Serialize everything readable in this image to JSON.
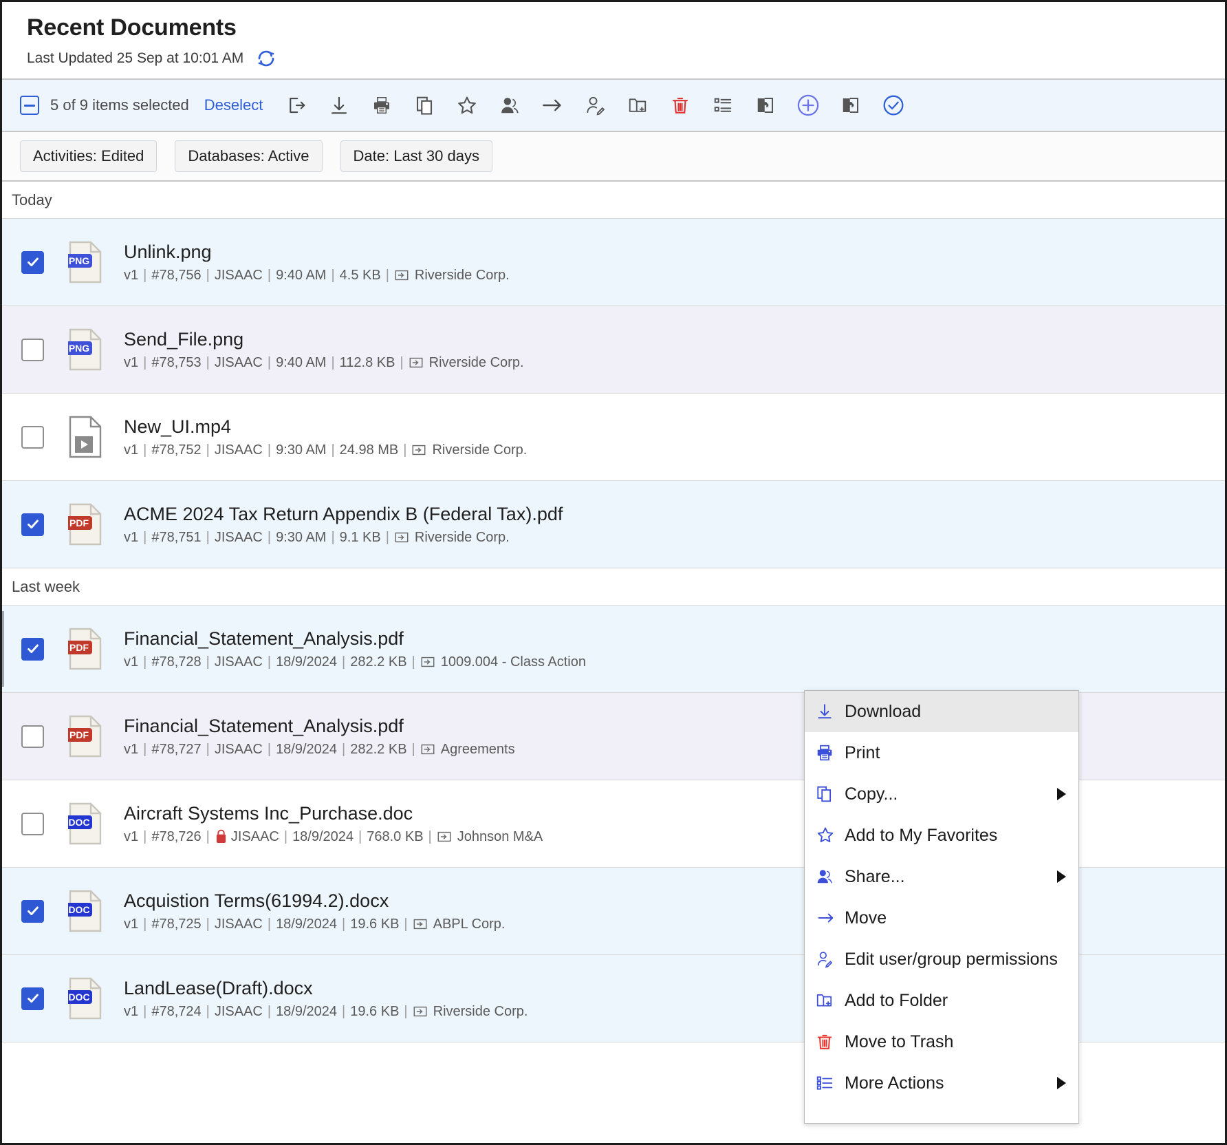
{
  "header": {
    "title": "Recent Documents",
    "last_updated": "Last Updated 25 Sep at 10:01 AM",
    "refresh_icon": "refresh-icon"
  },
  "toolbar": {
    "selected_text": "5 of 9 items selected",
    "deselect_label": "Deselect",
    "icons": [
      "exit-icon",
      "download-icon",
      "print-icon",
      "copy-icon",
      "star-icon",
      "share-user-icon",
      "move-arrow-icon",
      "edit-permissions-icon",
      "add-to-folder-icon",
      "trash-icon",
      "more-actions-icon",
      "puzzle-left-icon",
      "add-circle-icon",
      "puzzle-right-icon",
      "check-circle-icon"
    ],
    "accent_color": "#2f5fd8",
    "danger_color": "#e03131"
  },
  "filters": [
    {
      "label": "Activities: Edited"
    },
    {
      "label": "Databases: Active"
    },
    {
      "label": "Date: Last 30 days"
    }
  ],
  "groups": [
    {
      "label": "Today",
      "rows": [
        {
          "name": "Unlink.png",
          "type": "PNG",
          "checked": true,
          "style": "sel",
          "accent": false,
          "locked": false,
          "version": "v1",
          "id": "#78,756",
          "user": "JISAAC",
          "time": "9:40 AM",
          "size": "4.5 KB",
          "database": "Riverside Corp."
        },
        {
          "name": "Send_File.png",
          "type": "PNG",
          "checked": false,
          "style": "alt",
          "accent": false,
          "locked": false,
          "version": "v1",
          "id": "#78,753",
          "user": "JISAAC",
          "time": "9:40 AM",
          "size": "112.8 KB",
          "database": "Riverside Corp."
        },
        {
          "name": "New_UI.mp4",
          "type": "VIDEO",
          "checked": false,
          "style": "plain",
          "accent": false,
          "locked": false,
          "version": "v1",
          "id": "#78,752",
          "user": "JISAAC",
          "time": "9:30 AM",
          "size": "24.98 MB",
          "database": "Riverside Corp."
        },
        {
          "name": "ACME 2024 Tax Return Appendix B (Federal Tax).pdf",
          "type": "PDF",
          "checked": true,
          "style": "sel",
          "accent": false,
          "locked": false,
          "version": "v1",
          "id": "#78,751",
          "user": "JISAAC",
          "time": "9:30 AM",
          "size": "9.1 KB",
          "database": "Riverside Corp."
        }
      ]
    },
    {
      "label": "Last week",
      "rows": [
        {
          "name": "Financial_Statement_Analysis.pdf",
          "type": "PDF",
          "checked": true,
          "style": "sel",
          "accent": true,
          "locked": false,
          "version": "v1",
          "id": "#78,728",
          "user": "JISAAC",
          "time": "18/9/2024",
          "size": "282.2 KB",
          "database": "1009.004 - Class Action"
        },
        {
          "name": "Financial_Statement_Analysis.pdf",
          "type": "PDF",
          "checked": false,
          "style": "alt",
          "accent": false,
          "locked": false,
          "version": "v1",
          "id": "#78,727",
          "user": "JISAAC",
          "time": "18/9/2024",
          "size": "282.2 KB",
          "database": "Agreements"
        },
        {
          "name": "Aircraft Systems Inc_Purchase.doc",
          "type": "DOC",
          "checked": false,
          "style": "plain",
          "accent": false,
          "locked": true,
          "version": "v1",
          "id": "#78,726",
          "user": "JISAAC",
          "time": "18/9/2024",
          "size": "768.0 KB",
          "database": "Johnson M&A"
        },
        {
          "name": "Acquistion Terms(61994.2).docx",
          "type": "DOC",
          "checked": true,
          "style": "sel",
          "accent": false,
          "locked": false,
          "version": "v1",
          "id": "#78,725",
          "user": "JISAAC",
          "time": "18/9/2024",
          "size": "19.6 KB",
          "database": "ABPL Corp."
        },
        {
          "name": "LandLease(Draft).docx",
          "type": "DOC",
          "checked": true,
          "style": "sel",
          "accent": false,
          "locked": false,
          "version": "v1",
          "id": "#78,724",
          "user": "JISAAC",
          "time": "18/9/2024",
          "size": "19.6 KB",
          "database": "Riverside Corp."
        }
      ]
    }
  ],
  "context_menu": {
    "items": [
      {
        "label": "Download",
        "icon": "download-icon",
        "submenu": false,
        "highlighted": true
      },
      {
        "label": "Print",
        "icon": "print-icon",
        "submenu": false,
        "highlighted": false
      },
      {
        "label": "Copy...",
        "icon": "copy-icon",
        "submenu": true,
        "highlighted": false
      },
      {
        "label": "Add to My Favorites",
        "icon": "star-icon",
        "submenu": false,
        "highlighted": false
      },
      {
        "label": "Share...",
        "icon": "share-user-icon",
        "submenu": true,
        "highlighted": false
      },
      {
        "label": "Move",
        "icon": "move-arrow-icon",
        "submenu": false,
        "highlighted": false
      },
      {
        "label": "Edit user/group permissions",
        "icon": "edit-permissions-icon",
        "submenu": false,
        "highlighted": false
      },
      {
        "label": "Add to Folder",
        "icon": "add-to-folder-icon",
        "submenu": false,
        "highlighted": false
      },
      {
        "label": "Move to Trash",
        "icon": "trash-icon",
        "submenu": false,
        "highlighted": false
      },
      {
        "label": "More Actions",
        "icon": "more-actions-icon",
        "submenu": true,
        "highlighted": false
      }
    ]
  },
  "colors": {
    "accent_blue": "#2f58d4",
    "menu_icon_blue": "#3b4fd8",
    "danger_red": "#e03131",
    "pdf_red": "#c0392b",
    "row_selected_bg": "#eef6fd",
    "row_alt_bg": "#f1f0f8"
  }
}
